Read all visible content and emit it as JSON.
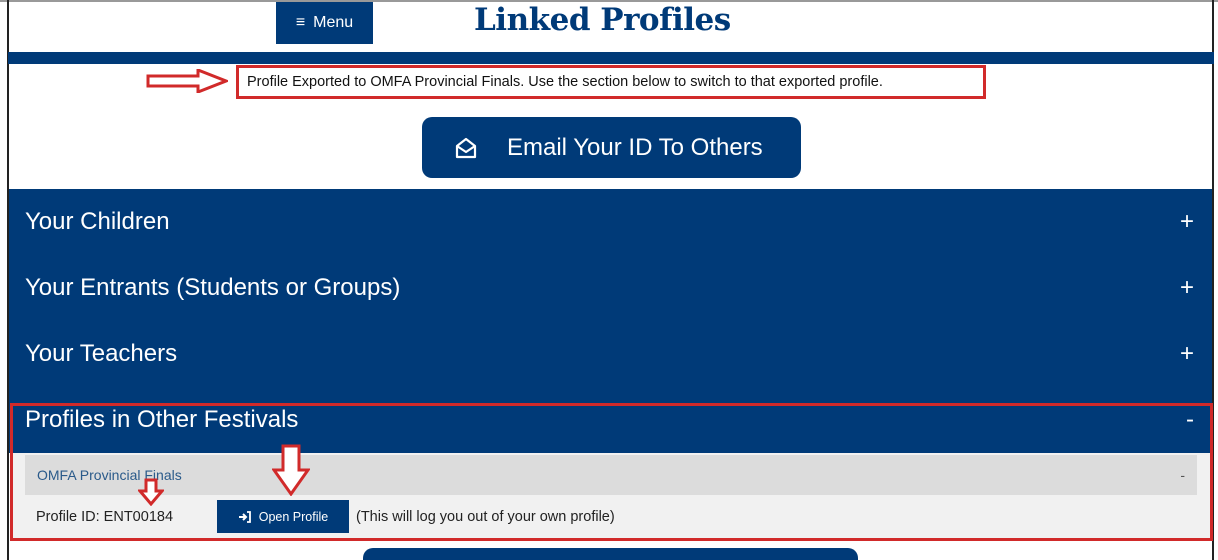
{
  "header": {
    "menu_label": "Menu",
    "menu_icon": "≡",
    "title": "Linked Profiles"
  },
  "notice": {
    "text": "Profile Exported to OMFA Provincial Finals. Use the section below to switch to that exported profile."
  },
  "email_button": {
    "label": "Email Your ID To Others",
    "icon": "envelope-open-icon"
  },
  "sections": [
    {
      "label": "Your Children",
      "toggle": "+"
    },
    {
      "label": "Your Entrants (Students or Groups)",
      "toggle": "+"
    },
    {
      "label": "Your Teachers",
      "toggle": "+"
    },
    {
      "label": "Profiles in Other Festivals",
      "toggle": "-"
    }
  ],
  "other_festivals": {
    "festival_name": "OMFA Provincial Finals",
    "festival_toggle": "-",
    "profile_id_label": "Profile ID: ENT00184",
    "open_button_label": "Open Profile",
    "open_button_icon": "sign-in-icon",
    "note": "(This will log you out of your own profile)"
  },
  "colors": {
    "brand_blue": "#003a78",
    "annotation_red": "#d12a2a",
    "panel_gray": "#dcdcdc"
  }
}
